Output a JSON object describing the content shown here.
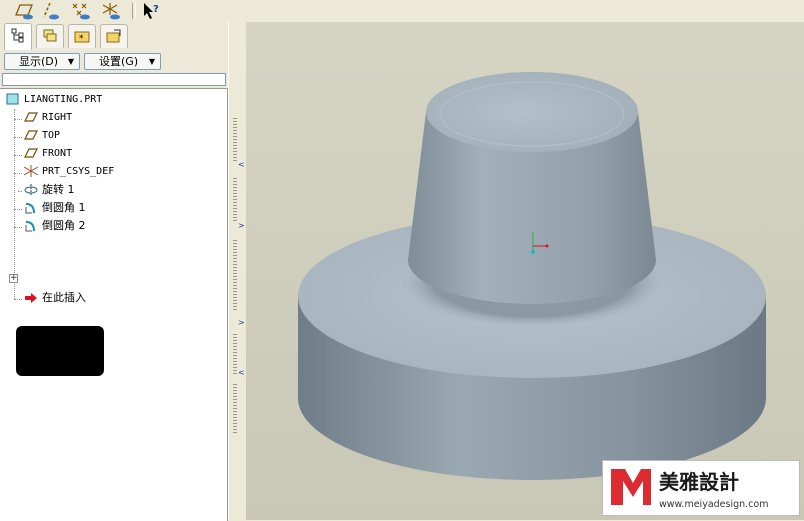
{
  "toolbar": {
    "icons": [
      "datum-plane-display-icon",
      "datum-axis-display-icon",
      "datum-point-display-icon",
      "csys-display-icon",
      "context-help-icon"
    ]
  },
  "navigator": {
    "tabs": [
      "model-tree-tab",
      "layers-tab",
      "folder-browser-tab",
      "favorites-tab"
    ],
    "show_menu": "显示(D)",
    "settings_menu": "设置(G)"
  },
  "model_tree": {
    "root": "LIANGTING.PRT",
    "items": [
      {
        "label": "RIGHT",
        "icon": "datum-plane-icon"
      },
      {
        "label": "TOP",
        "icon": "datum-plane-icon"
      },
      {
        "label": "FRONT",
        "icon": "datum-plane-icon"
      },
      {
        "label": "PRT_CSYS_DEF",
        "icon": "coordinate-system-icon"
      },
      {
        "label": "旋转 1",
        "icon": "revolve-icon"
      },
      {
        "label": "倒圆角 1",
        "icon": "round-icon"
      },
      {
        "label": "倒圆角 2",
        "icon": "round-icon"
      },
      {
        "label": "在此插入",
        "icon": "insert-here-arrow-icon"
      }
    ]
  },
  "viewport": {
    "background": "#cfcdbc",
    "model_color": "#9aa7b1"
  },
  "watermark": {
    "brand": "美雅設計",
    "url": "www.meiyadesign.com"
  }
}
